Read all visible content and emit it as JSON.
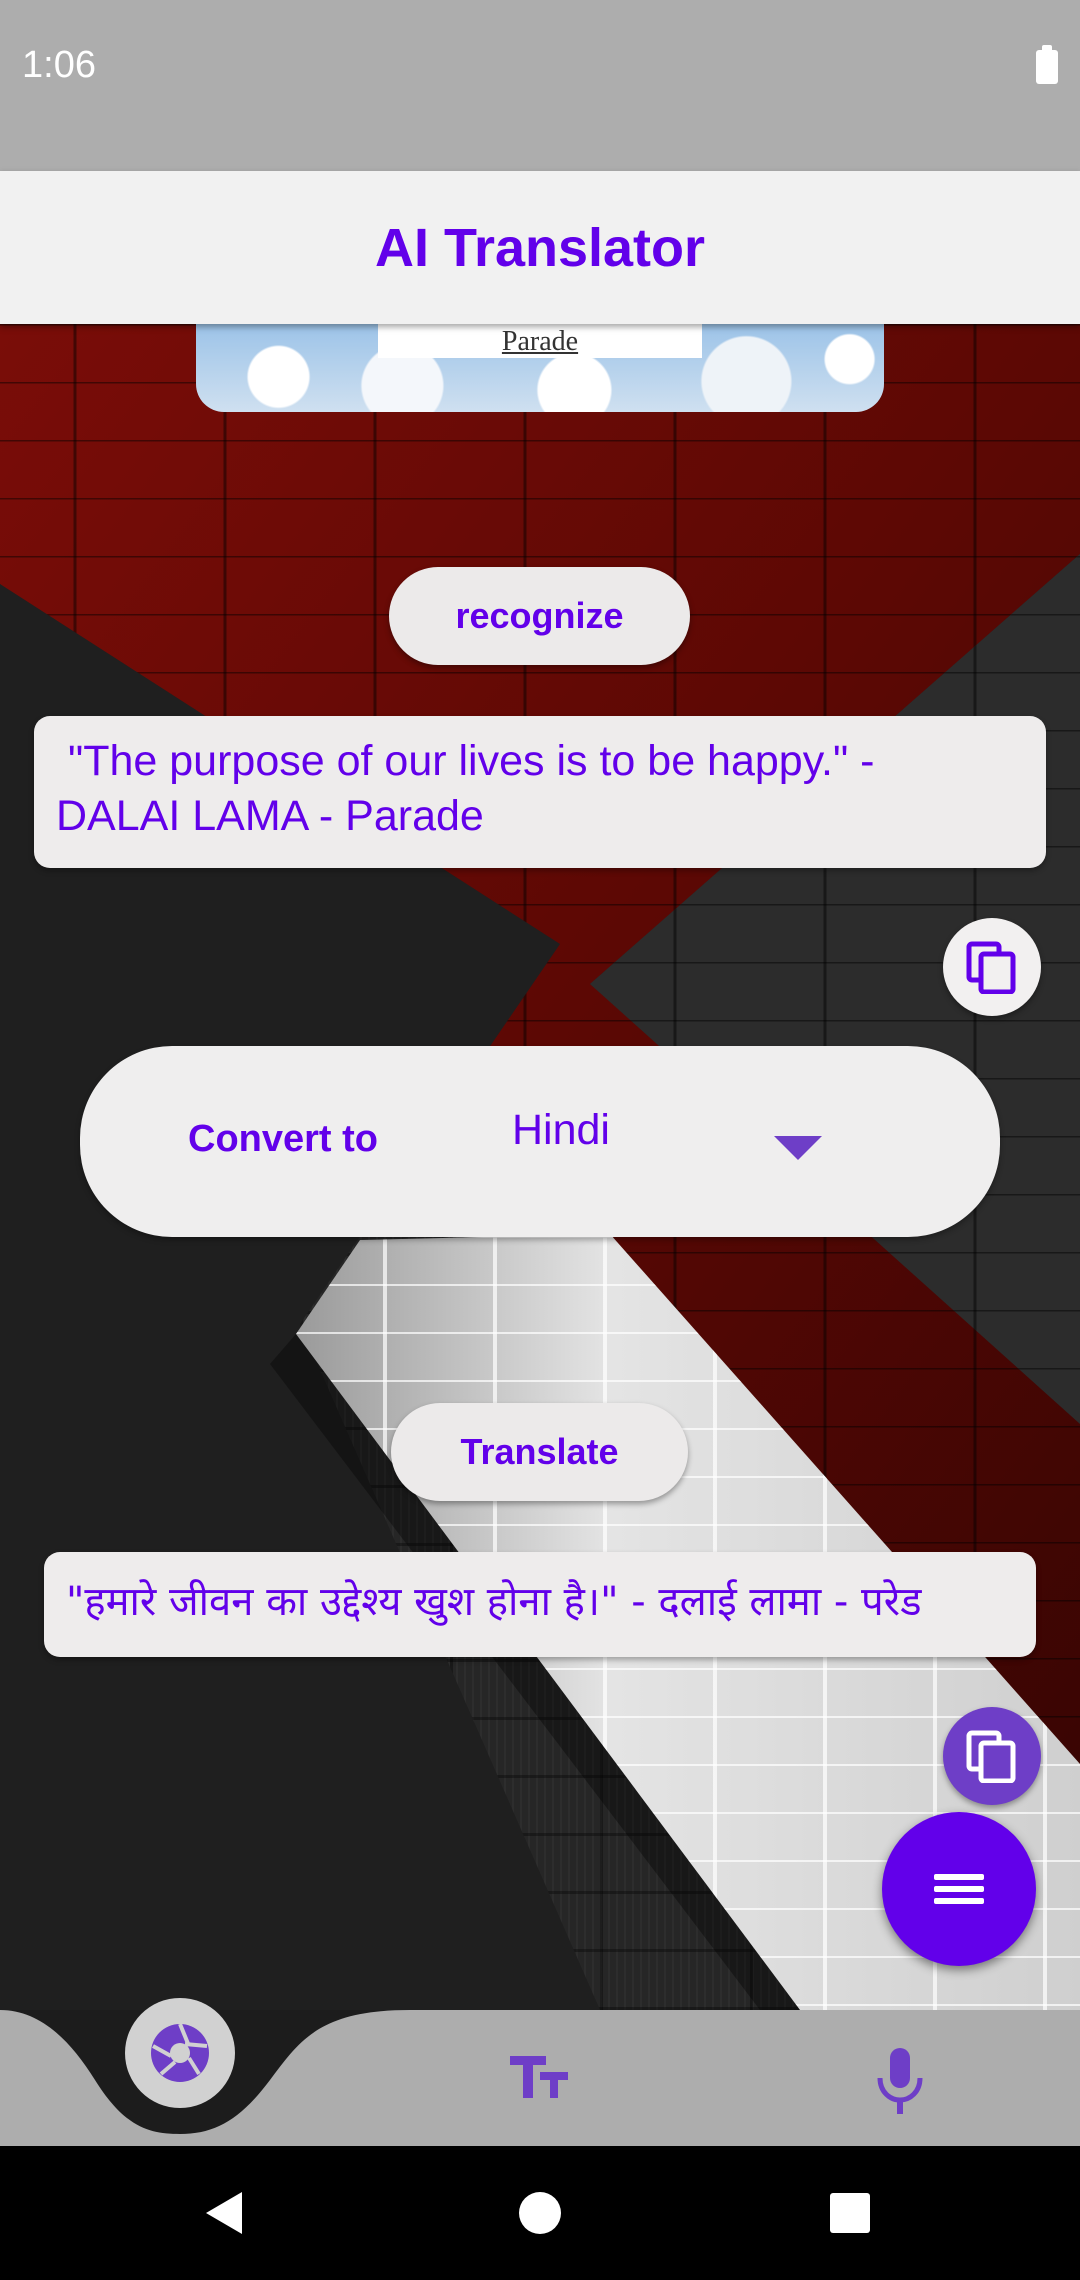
{
  "status_bar": {
    "time": "1:06",
    "battery_icon": "battery-full-icon"
  },
  "app_bar": {
    "title": "AI Translator"
  },
  "image_preview": {
    "caption": "Parade"
  },
  "buttons": {
    "recognize_label": "recognize",
    "translate_label": "Translate"
  },
  "source_text": " \"The purpose of our lives is to be happy.\" -\nDALAI LAMA - Parade",
  "convert": {
    "label": "Convert to",
    "selected_language": "Hindi"
  },
  "result_text": "\"हमारे जीवन का उद्देश्य खुश होना है।\" - दलाई लामा - परेड",
  "icons": {
    "copy": "copy-icon",
    "menu": "menu-icon",
    "camera": "camera-aperture-icon",
    "text": "text-size-icon",
    "mic": "microphone-icon",
    "dropdown": "triangle-down-icon"
  },
  "colors": {
    "accent": "#6200ea",
    "secondary": "#6e3ec7",
    "surface": "#eeecec",
    "bar": "#adadad"
  }
}
